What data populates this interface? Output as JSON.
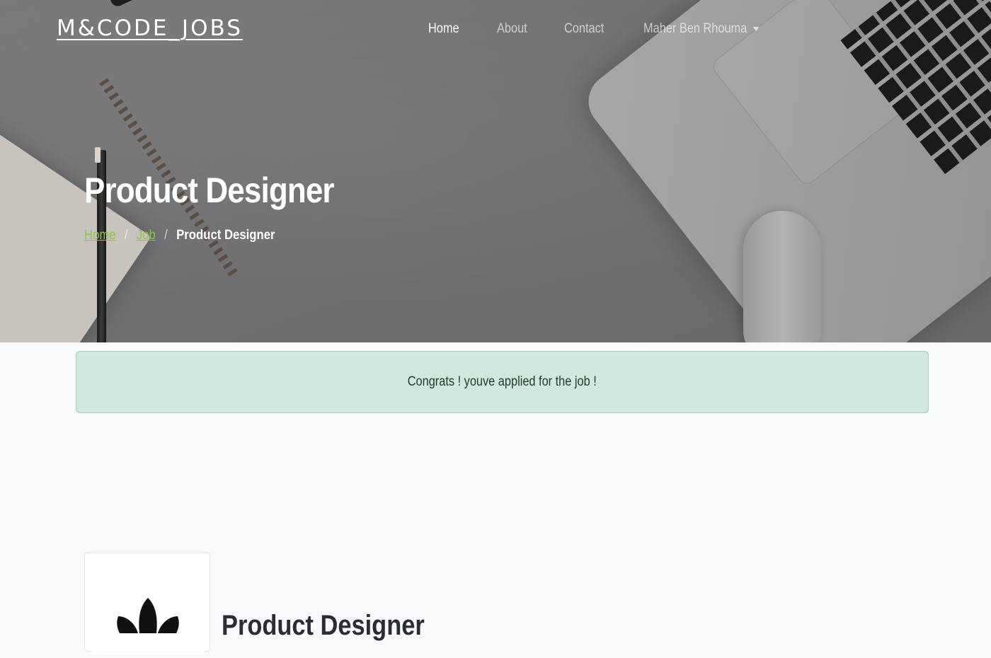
{
  "brand": "M&CODE_JOBS",
  "nav": {
    "items": [
      {
        "label": "Home",
        "active": true
      },
      {
        "label": "About",
        "active": false
      },
      {
        "label": "Contact",
        "active": false
      }
    ],
    "user_label": "Maher Ben Rhouma"
  },
  "hero": {
    "title": "Product Designer",
    "breadcrumb": {
      "home": "Home",
      "job": "Job",
      "current": "Product Designer"
    }
  },
  "alert": {
    "message": "Congrats ! youve applied for the job !"
  },
  "job": {
    "title": "Product Designer",
    "logo_icon": "adidas-style-leaf-logo"
  },
  "colors": {
    "accent": "#8bc34a",
    "alert_bg": "#d1e7dd",
    "alert_border": "#a3cfbb",
    "page_bg": "#f8f9fb"
  }
}
